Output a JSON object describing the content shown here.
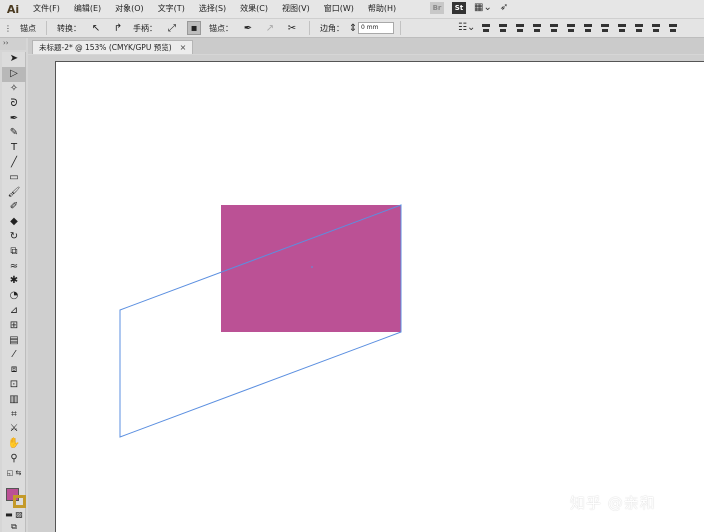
{
  "app": {
    "logo": "Ai"
  },
  "menu": [
    "文件(F)",
    "编辑(E)",
    "对象(O)",
    "文字(T)",
    "选择(S)",
    "效果(C)",
    "视图(V)",
    "窗口(W)",
    "帮助(H)"
  ],
  "menu_right": {
    "bridge": "Br",
    "stock": "St"
  },
  "control_bar": {
    "anchor_label": "锚点",
    "convert_label": "转换：",
    "handle_label": "手柄：",
    "anchor_points_label": "锚点：",
    "corner_label": "边角：",
    "corner_value": "0 mm"
  },
  "tab": {
    "title": "未标题-2* @ 153% (CMYK/GPU 预览)",
    "close": "×"
  },
  "toolbox_header": "››",
  "shapes": {
    "rect_fill": "#bb5195",
    "path_stroke": "#5b8fe0"
  },
  "watermark": "知乎 @亲和"
}
